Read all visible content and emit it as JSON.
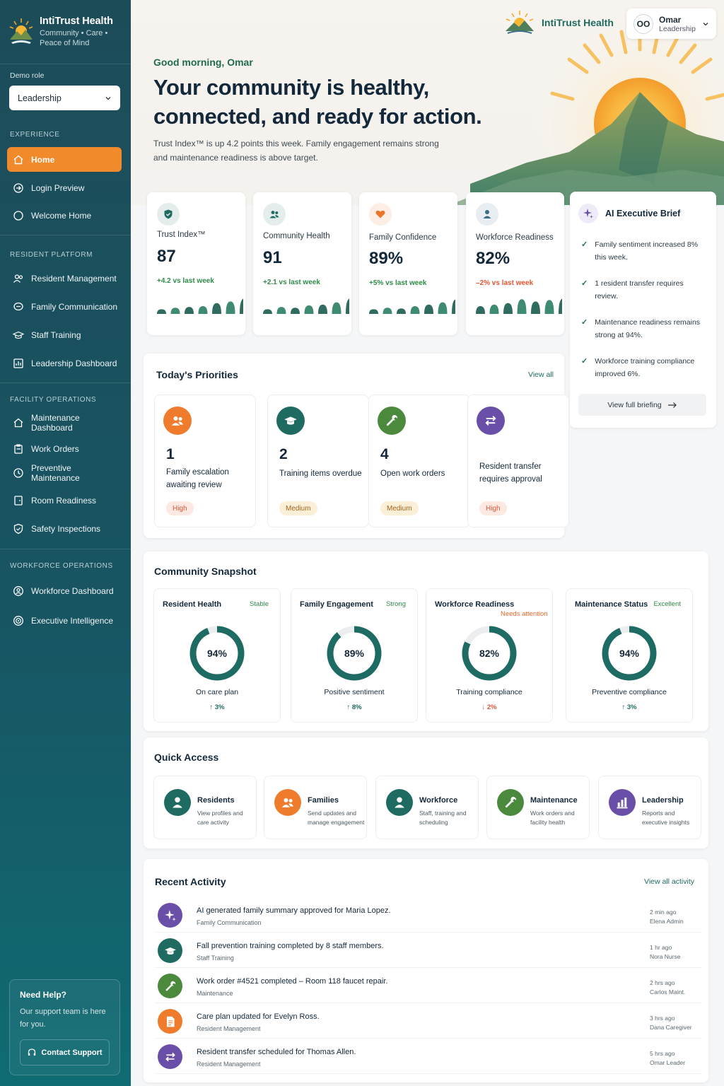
{
  "brand": {
    "name": "IntiTrust Health",
    "tagline": "Community • Care • Peace of Mind"
  },
  "top_brand": {
    "name": "IntiTrust Health"
  },
  "user": {
    "initials": "OO",
    "name": "Omar",
    "role": "Leadership"
  },
  "demo_role": {
    "label": "Demo role",
    "value": "Leadership"
  },
  "nav": {
    "experience": {
      "label": "EXPERIENCE",
      "items": [
        {
          "label": "Home",
          "icon": "home-icon",
          "active": true
        },
        {
          "label": "Login Preview",
          "icon": "login-icon"
        },
        {
          "label": "Welcome Home",
          "icon": "circle-icon"
        }
      ]
    },
    "resident": {
      "label": "RESIDENT PLATFORM",
      "items": [
        {
          "label": "Resident Management",
          "icon": "users-icon"
        },
        {
          "label": "Family Communication",
          "icon": "chat-icon"
        },
        {
          "label": "Staff Training",
          "icon": "graduation-cap-icon"
        },
        {
          "label": "Leadership Dashboard",
          "icon": "dashboard-icon"
        }
      ]
    },
    "facility": {
      "label": "FACILITY OPERATIONS",
      "items": [
        {
          "label": "Maintenance Dashboard",
          "icon": "home-icon"
        },
        {
          "label": "Work Orders",
          "icon": "clipboard-icon"
        },
        {
          "label": "Preventive Maintenance",
          "icon": "clock-icon"
        },
        {
          "label": "Room Readiness",
          "icon": "door-icon"
        },
        {
          "label": "Safety Inspections",
          "icon": "shield-icon"
        }
      ]
    },
    "workforce": {
      "label": "WORKFORCE OPERATIONS",
      "items": [
        {
          "label": "Workforce Dashboard",
          "icon": "user-circle-icon"
        },
        {
          "label": "Executive Intelligence",
          "icon": "target-icon"
        }
      ]
    }
  },
  "help": {
    "title": "Need Help?",
    "text": "Our support team is here for you.",
    "button": "Contact Support"
  },
  "hero": {
    "greeting": "Good morning, Omar",
    "headline": "Your community is healthy, connected, and ready for action.",
    "subline": "Trust Index™ is up 4.2 points this week. Family engagement remains strong and maintenance readiness is above target."
  },
  "kpis": [
    {
      "title": "Trust Index™",
      "value": "87",
      "delta": "+4.2 vs last week",
      "trend": "up",
      "icon": "shield-icon",
      "color": "#1f6b62",
      "bars": [
        0.3,
        0.4,
        0.45,
        0.5,
        0.7,
        0.8,
        1.0
      ]
    },
    {
      "title": "Community Health",
      "value": "91",
      "delta": "+2.1 vs last week",
      "trend": "up",
      "icon": "users-icon",
      "color": "#1f6b62",
      "bars": [
        0.3,
        0.45,
        0.4,
        0.55,
        0.6,
        0.75,
        1.0
      ]
    },
    {
      "title": "Family Confidence",
      "value": "89%",
      "delta": "+5% vs last week",
      "trend": "up",
      "icon": "heart-icon",
      "color": "#e9762a",
      "bars": [
        0.3,
        0.4,
        0.35,
        0.5,
        0.6,
        0.75,
        0.95
      ]
    },
    {
      "title": "Workforce Readiness",
      "value": "82%",
      "delta": "–2% vs last week",
      "trend": "down",
      "icon": "user-icon",
      "color": "#3d6e86",
      "bars": [
        0.5,
        0.6,
        0.7,
        0.95,
        0.8,
        0.9,
        1.0
      ]
    }
  ],
  "brief": {
    "title": "AI Executive Brief",
    "items": [
      "Family sentiment increased 8% this week.",
      "1 resident transfer requires review.",
      "Maintenance readiness remains strong at 94%.",
      "Workforce training compliance improved 6%."
    ],
    "button": "View full briefing"
  },
  "priorities": {
    "title": "Today's Priorities",
    "view_all": "View all",
    "items": [
      {
        "number": "1",
        "text": "Family escalation awaiting review",
        "badge": "High",
        "level": "high",
        "icon": "users-icon",
        "color": "#ef7b2d"
      },
      {
        "number": "2",
        "text": "Training items overdue",
        "badge": "Medium",
        "level": "med",
        "icon": "graduation-cap-icon",
        "color": "#1f6b62"
      },
      {
        "number": "4",
        "text": "Open work orders",
        "badge": "Medium",
        "level": "med",
        "icon": "wrench-icon",
        "color": "#4b8a3c"
      },
      {
        "number": "",
        "text": "Resident transfer requires approval",
        "badge": "High",
        "level": "high",
        "icon": "transfer-icon",
        "color": "#6a4fa8"
      }
    ]
  },
  "snapshot": {
    "title": "Community Snapshot",
    "items": [
      {
        "title": "Resident Health",
        "status": "Stable",
        "status_color": "#2f8a4a",
        "value": 94,
        "value_label": "94%",
        "label": "On care plan",
        "delta": "↑ 3%",
        "delta_color": "#1f6b62"
      },
      {
        "title": "Family Engagement",
        "status": "Strong",
        "status_color": "#2f8a4a",
        "value": 89,
        "value_label": "89%",
        "label": "Positive sentiment",
        "delta": "↑ 8%",
        "delta_color": "#1f6b62"
      },
      {
        "title": "Workforce Readiness",
        "status": "Needs attention",
        "status_color": "#e26a2c",
        "value": 82,
        "value_label": "82%",
        "label": "Training compliance",
        "delta": "↓ 2%",
        "delta_color": "#d9563a"
      },
      {
        "title": "Maintenance Status",
        "status": "Excellent",
        "status_color": "#2f8a4a",
        "value": 94,
        "value_label": "94%",
        "label": "Preventive compliance",
        "delta": "↑ 3%",
        "delta_color": "#1f6b62"
      }
    ]
  },
  "quick_access": {
    "title": "Quick Access",
    "items": [
      {
        "title": "Residents",
        "desc": "View profiles and care activity",
        "icon": "user-icon",
        "color": "#1f6b62"
      },
      {
        "title": "Families",
        "desc": "Send updates and manage engagement",
        "icon": "users-icon",
        "color": "#ef7b2d"
      },
      {
        "title": "Workforce",
        "desc": "Staff, training and scheduling",
        "icon": "user-icon",
        "color": "#1f6b62"
      },
      {
        "title": "Maintenance",
        "desc": "Work orders and facility health",
        "icon": "wrench-icon",
        "color": "#4b8a3c"
      },
      {
        "title": "Leadership",
        "desc": "Reports and executive insights",
        "icon": "bar-chart-icon",
        "color": "#6a4fa8"
      }
    ]
  },
  "activity": {
    "title": "Recent Activity",
    "view_all": "View all activity",
    "items": [
      {
        "title": "AI generated family summary approved for Maria Lopez.",
        "category": "Family Communication",
        "time": "2 min ago",
        "who": "Elena Admin",
        "icon": "sparkle-icon",
        "color": "#6a4fa8"
      },
      {
        "title": "Fall prevention training completed by 8 staff members.",
        "category": "Staff Training",
        "time": "1 hr ago",
        "who": "Nora Nurse",
        "icon": "graduation-cap-icon",
        "color": "#1f6b62"
      },
      {
        "title": "Work order #4521 completed – Room 118 faucet repair.",
        "category": "Maintenance",
        "time": "2 hrs ago",
        "who": "Carlos Maint.",
        "icon": "wrench-icon",
        "color": "#4b8a3c"
      },
      {
        "title": "Care plan updated for Evelyn Ross.",
        "category": "Resident Management",
        "time": "3 hrs ago",
        "who": "Dana Caregiver",
        "icon": "document-icon",
        "color": "#ef7b2d"
      },
      {
        "title": "Resident transfer scheduled for Thomas Allen.",
        "category": "Resident Management",
        "time": "5 hrs ago",
        "who": "Omar Leader",
        "icon": "transfer-icon",
        "color": "#6a4fa8"
      }
    ]
  }
}
